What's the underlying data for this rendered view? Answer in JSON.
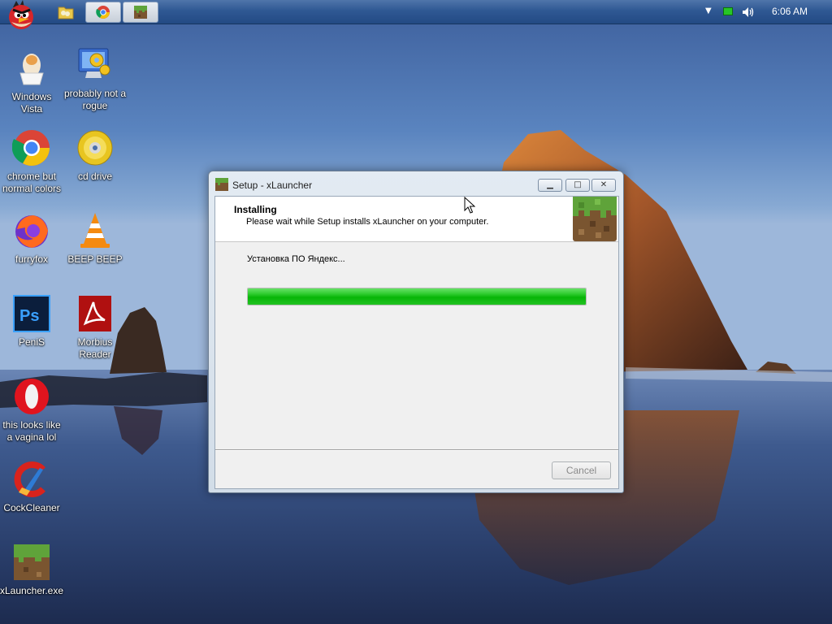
{
  "taskbar": {
    "clock": "6:06 AM"
  },
  "desktop_icons": [
    {
      "label": "Windows Vista",
      "icon": "egg-icon"
    },
    {
      "label": "probably not a rogue",
      "icon": "computer-gears-icon"
    },
    {
      "label": "chrome but normal colors",
      "icon": "chrome-icon"
    },
    {
      "label": "cd drive",
      "icon": "cd-icon"
    },
    {
      "label": "furryfox",
      "icon": "firefox-icon"
    },
    {
      "label": "BEEP BEEP",
      "icon": "vlc-cone-icon"
    },
    {
      "label": "PeniS",
      "icon": "photoshop-icon"
    },
    {
      "label": "Morbius Reader",
      "icon": "pdf-reader-icon"
    },
    {
      "label": "this looks like a vagina lol",
      "icon": "opera-icon"
    },
    {
      "label": "CockCleaner",
      "icon": "ccleaner-icon"
    },
    {
      "label": "xLauncher.exe",
      "icon": "grass-block-icon"
    }
  ],
  "setup_window": {
    "title": "Setup - xLauncher",
    "header_title": "Installing",
    "header_subtitle": "Please wait while Setup installs xLauncher on your computer.",
    "status_text": "Установка ПО Яндекс...",
    "progress_percent": 100,
    "cancel_label": "Cancel",
    "cancel_enabled": false
  },
  "colors": {
    "progress_green": "#08b508",
    "taskbar_blue": "#2f5893"
  }
}
